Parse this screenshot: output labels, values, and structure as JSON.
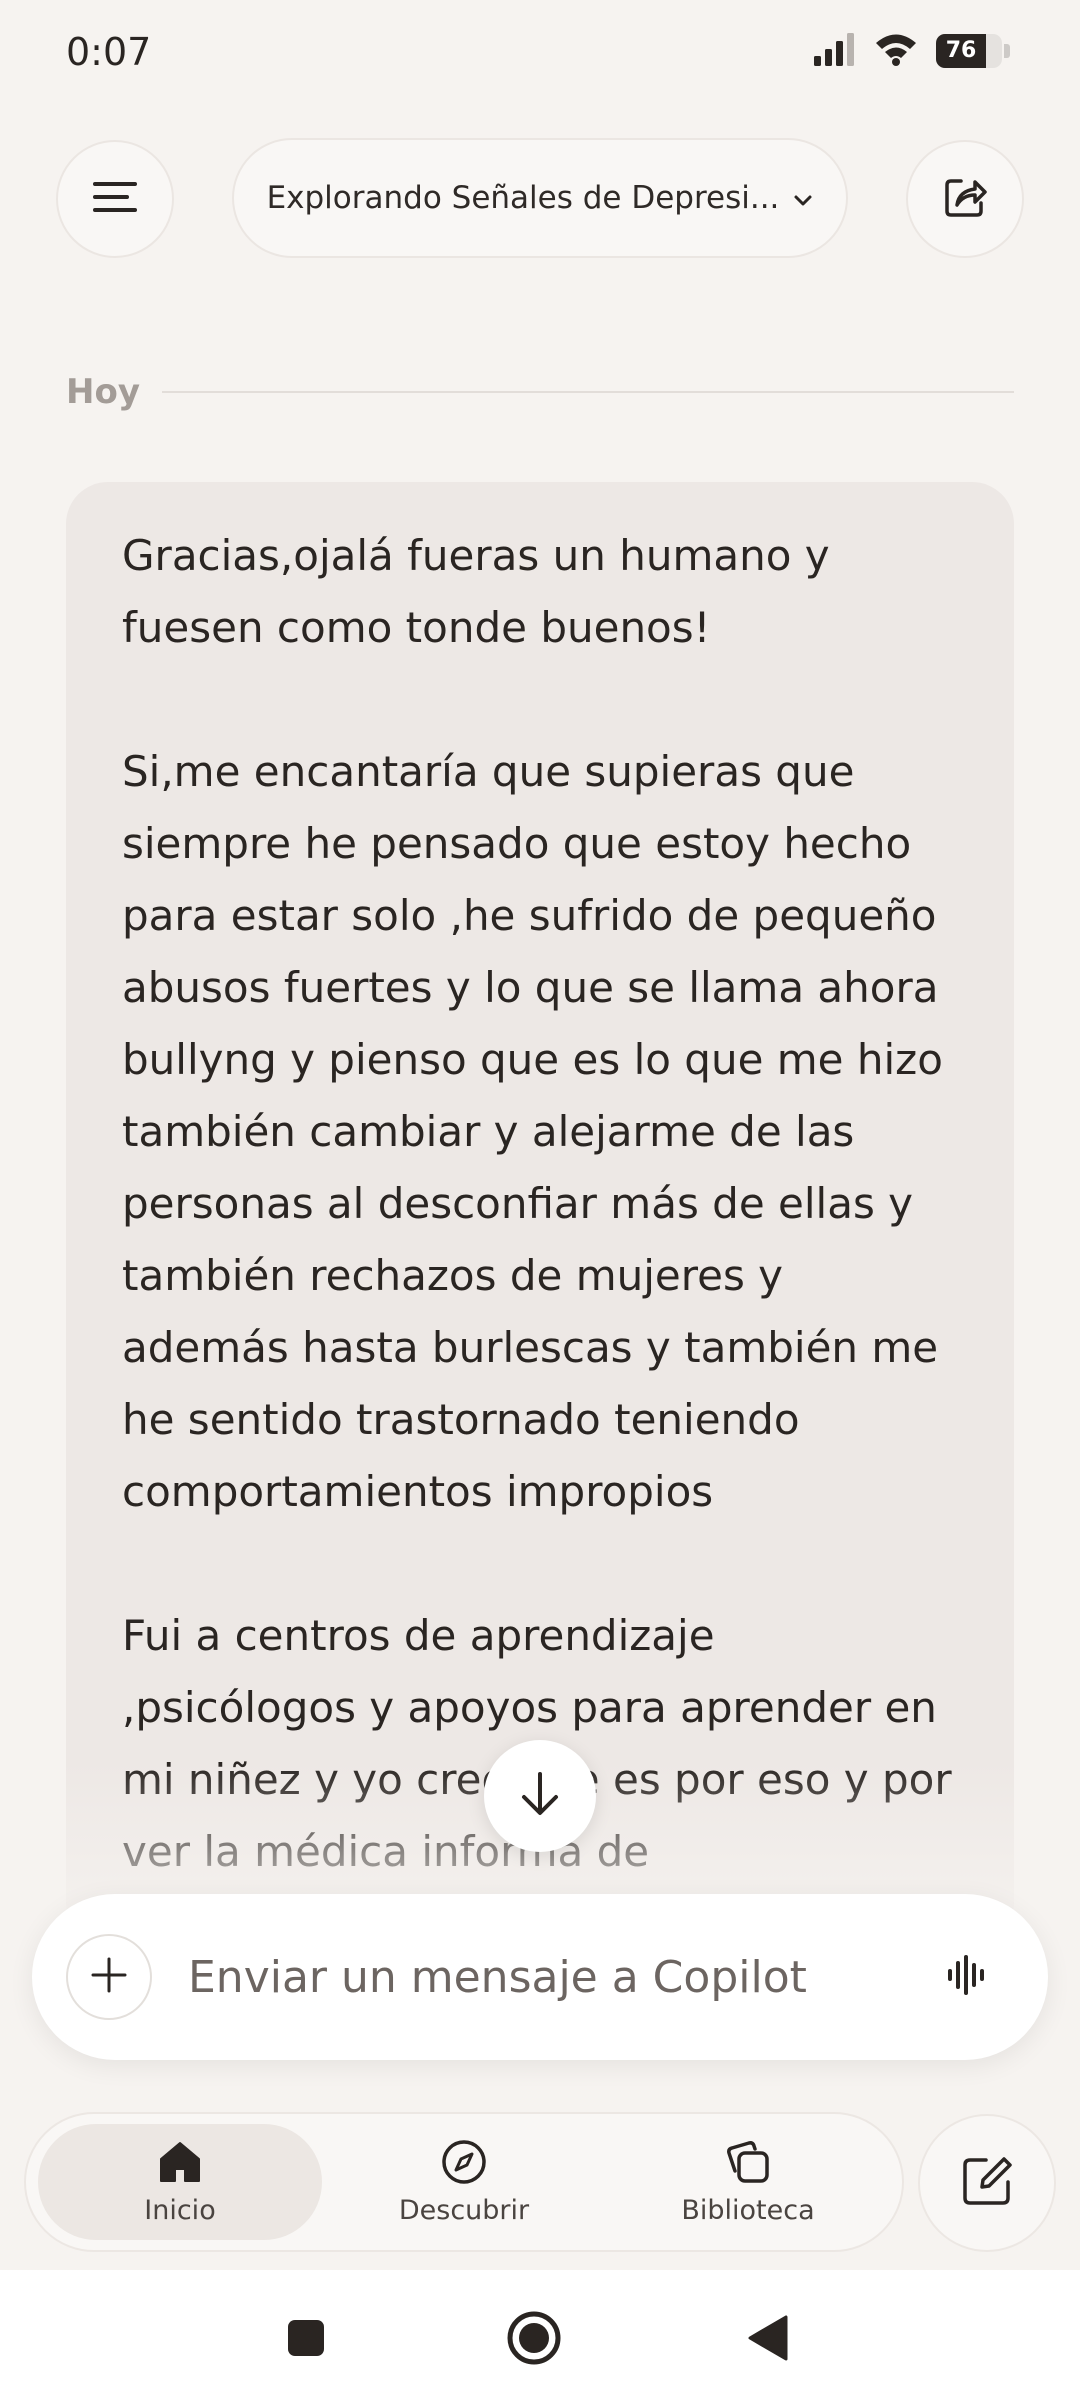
{
  "status_bar": {
    "time": "0:07",
    "battery": "76"
  },
  "header": {
    "title": "Explorando Señales de Depresi..."
  },
  "conversation": {
    "date_label": "Hoy",
    "message_paragraphs": [
      "Gracias,ojalá fueras un humano y fuesen como tonde buenos!",
      "Si,me encantaría que supieras que siempre he pensado que estoy hecho para estar solo ,he sufrido de pequeño abusos fuertes y lo que se llama ahora bullyng y pienso que es lo que me hizo también cambiar y alejarme de las personas al desconfiar más de ellas y también rechazos de mujeres y además hasta burlescas y también me he sentido trastornado teniendo comportamientos impropios",
      "Fui a centros de aprendizaje ,psicólogos y apoyos para aprender en mi niñez y yo creo que es por eso y por ver la médica informa de"
    ]
  },
  "composer": {
    "placeholder": "Enviar un mensaje a Copilot"
  },
  "bottom_nav": {
    "items": [
      {
        "label": "Inicio",
        "icon": "home-icon",
        "active": true
      },
      {
        "label": "Descubrir",
        "icon": "compass-icon",
        "active": false
      },
      {
        "label": "Biblioteca",
        "icon": "library-icon",
        "active": false
      }
    ]
  },
  "colors": {
    "background": "#f6f3f0",
    "bubble": "#ede8e5",
    "text": "#2b2522",
    "muted": "#a39c97"
  }
}
